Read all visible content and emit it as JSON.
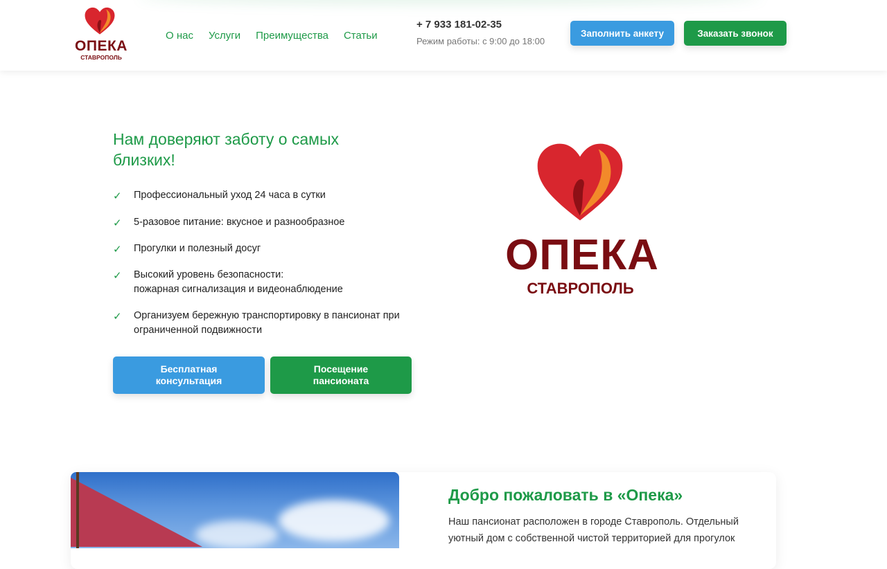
{
  "header": {
    "logo": {
      "title": "ОПЕКА",
      "subtitle": "СТАВРОПОЛЬ"
    },
    "nav": [
      {
        "label": "О нас"
      },
      {
        "label": "Услуги"
      },
      {
        "label": "Преимущества"
      },
      {
        "label": "Статьи"
      }
    ],
    "phone": "+ 7 933 181-02-35",
    "hours": "Режим работы: с 9:00 до 18:00",
    "form_button": "Заполнить анкету",
    "call_button": "Заказать звонок"
  },
  "hero": {
    "title": "Нам доверяют заботу о самых близких!",
    "features": [
      "Профессиональный уход 24 часа в сутки",
      "5-разовое питание: вкусное и разнообразное",
      "Прогулки и полезный досуг",
      "Высокий уровень безопасности:\nпожарная сигнализация и видеонаблюдение",
      "Организуем бережную транспортировку в пансионат при ограниченной подвижности"
    ],
    "consult_button": "Бесплатная\nконсультация",
    "visit_button": "Посещение\nпансионата",
    "logo": {
      "title": "ОПЕКА",
      "subtitle": "СТАВРОПОЛЬ"
    }
  },
  "welcome": {
    "title": "Добро пожаловать в «Опека»",
    "text": "Наш пансионат расположен в городе Ставрополь. Отдельный уютный дом с собственной чистой территорией для прогулок"
  },
  "colors": {
    "accent_green": "#1e9a48",
    "accent_blue": "#3a9be0",
    "logo_dark_red": "#7a0d12"
  }
}
